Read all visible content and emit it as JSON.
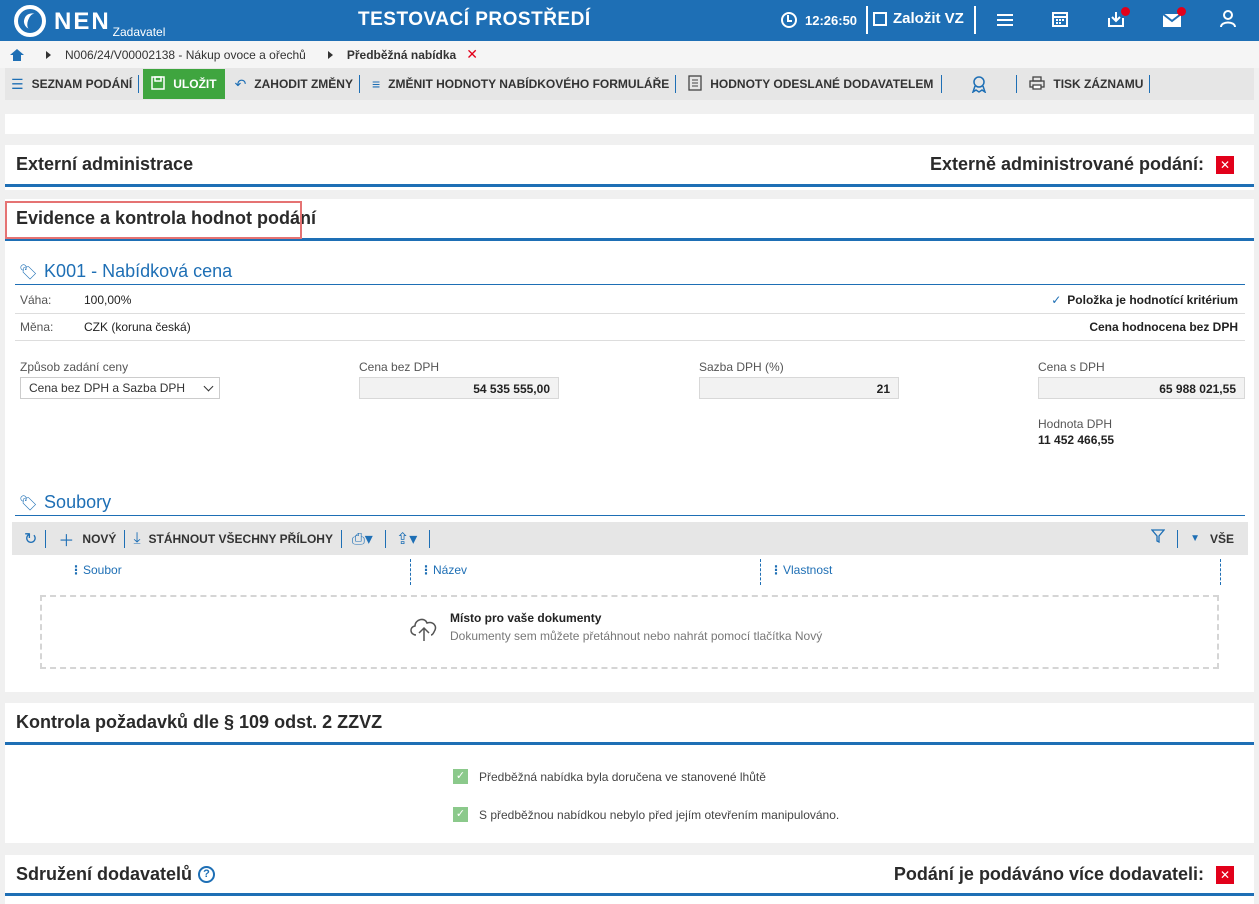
{
  "header": {
    "logo": "NEN",
    "logo_sub": "Zadavatel",
    "env_title": "TESTOVACÍ PROSTŘEDÍ",
    "time": "12:26:50",
    "new_vz": "Založit VZ"
  },
  "breadcrumb": {
    "item1": "N006/24/V00002138 - Nákup ovoce a ořechů",
    "current": "Předběžná nabídka"
  },
  "toolbar": {
    "list": "SEZNAM PODÁNÍ",
    "save": "ULOŽIT",
    "discard": "ZAHODIT ZMĚNY",
    "change_values": "ZMĚNIT HODNOTY NABÍDKOVÉHO FORMULÁŘE",
    "sent_values": "HODNOTY ODESLANÉ DODAVATELEM",
    "print": "TISK ZÁZNAMU"
  },
  "external": {
    "title": "Externí administrace",
    "right_label": "Externě administrované podání:"
  },
  "evidence": {
    "title": "Evidence a kontrola hodnot podání",
    "criterion": {
      "title": "K001 - Nabídková cena",
      "weight_label": "Váha:",
      "weight_value": "100,00%",
      "currency_label": "Měna:",
      "currency_value": "CZK (koruna česká)",
      "is_criterion": "Položka je hodnotící kritérium",
      "price_note": "Cena hodnocena bez DPH",
      "method_label": "Způsob zadání ceny",
      "method_value": "Cena bez DPH a Sazba DPH",
      "price_no_vat_label": "Cena bez DPH",
      "price_no_vat_value": "54 535 555,00",
      "vat_rate_label": "Sazba DPH (%)",
      "vat_rate_value": "21",
      "price_vat_label": "Cena s DPH",
      "price_vat_value": "65 988 021,55",
      "vat_amount_label": "Hodnota DPH",
      "vat_amount_value": "11 452 466,55"
    },
    "files": {
      "title": "Soubory",
      "new": "NOVÝ",
      "download_all": "STÁHNOUT VŠECHNY PŘÍLOHY",
      "all": "VŠE",
      "columns": [
        "Soubor",
        "Název",
        "Vlastnost"
      ],
      "drop_title": "Místo pro vaše dokumenty",
      "drop_sub": "Dokumenty sem můžete přetáhnout nebo nahrát pomocí tlačítka Nový"
    }
  },
  "control": {
    "title": "Kontrola požadavků dle § 109 odst. 2 ZZVZ",
    "checks": [
      "Předběžná nabídka byla doručena ve stanovené lhůtě",
      "S předběžnou nabídkou nebylo před jejím otevřením manipulováno."
    ]
  },
  "association": {
    "title": "Sdružení dodavatelů",
    "right_label": "Podání je podáváno více dodavateli:"
  },
  "colors": {
    "primary": "#1e6fb5",
    "save": "#3fa53f",
    "danger": "#e2001a",
    "check": "#8bc98b"
  }
}
